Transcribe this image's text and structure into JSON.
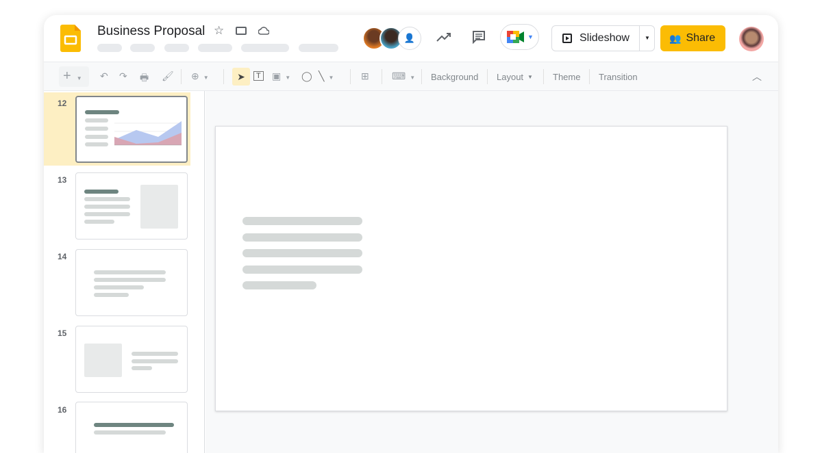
{
  "header": {
    "title": "Business Proposal",
    "icons": [
      "star-icon",
      "move-to-folder-icon",
      "cloud-saved-icon"
    ]
  },
  "actions": {
    "slideshow_label": "Slideshow",
    "share_label": "Share"
  },
  "toolbar": {
    "background": "Background",
    "layout": "Layout",
    "theme": "Theme",
    "transition": "Transition"
  },
  "filmstrip": {
    "slides": [
      {
        "number": "12",
        "selected": true
      },
      {
        "number": "13"
      },
      {
        "number": "14"
      },
      {
        "number": "15"
      },
      {
        "number": "16"
      }
    ]
  },
  "colors": {
    "accent": "#fbbc04",
    "selected_slide_bg": "#fdefc3"
  }
}
